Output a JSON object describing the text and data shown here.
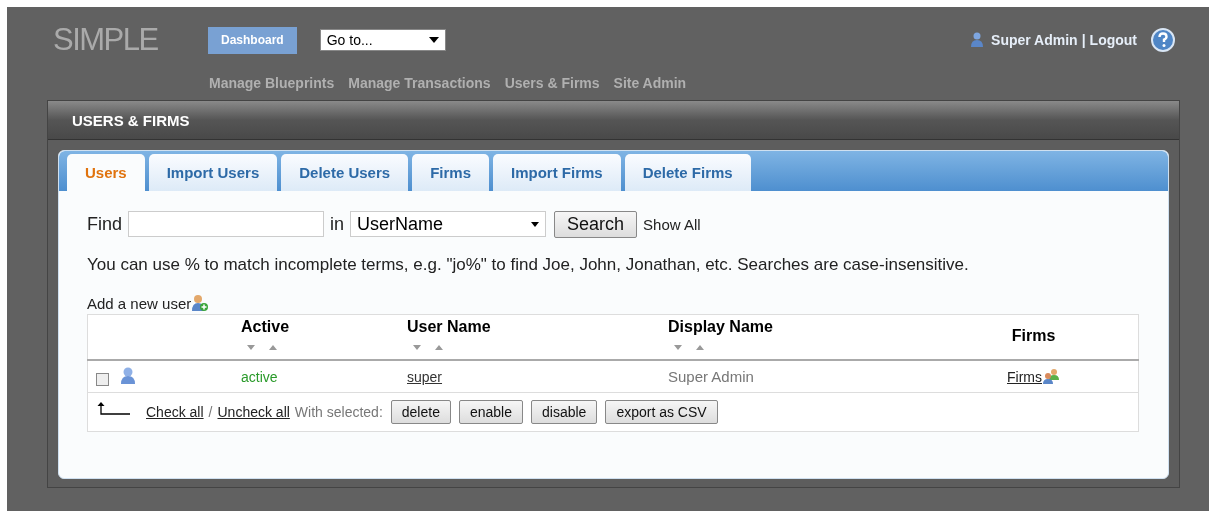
{
  "logo": "SIMPLE",
  "dashboard_button": "Dashboard",
  "goto_select": {
    "value": "Go to..."
  },
  "user_menu": {
    "name": "Super Admin",
    "separator": "|",
    "logout": "Logout"
  },
  "nav": [
    "Manage Blueprints",
    "Manage Transactions",
    "Users & Firms",
    "Site Admin"
  ],
  "panel": {
    "title": "USERS & FIRMS"
  },
  "tabs": [
    {
      "label": "Users",
      "selected": true
    },
    {
      "label": "Import Users",
      "selected": false
    },
    {
      "label": "Delete Users",
      "selected": false
    },
    {
      "label": "Firms",
      "selected": false
    },
    {
      "label": "Import Firms",
      "selected": false
    },
    {
      "label": "Delete Firms",
      "selected": false
    }
  ],
  "search": {
    "find_label": "Find",
    "in_label": "in",
    "field_value": "UserName",
    "button": "Search",
    "show_all": "Show All"
  },
  "hint": "You can use % to match incomplete terms, e.g. \"jo%\" to find Joe, John, Jonathan, etc. Searches are case-insensitive.",
  "add_user": "Add a new user",
  "table": {
    "columns": [
      {
        "label": "Active",
        "sortable": true
      },
      {
        "label": "User Name",
        "sortable": true
      },
      {
        "label": "Display Name",
        "sortable": true
      },
      {
        "label": "Firms",
        "sortable": false
      }
    ],
    "rows": [
      {
        "checked": false,
        "active": "active",
        "user_name": "super",
        "display_name": "Super Admin",
        "firms": "Firms"
      }
    ]
  },
  "bulk": {
    "check_all": "Check all",
    "slash": "/",
    "uncheck_all": "Uncheck all",
    "with_selected": "With selected:",
    "buttons": [
      "delete",
      "enable",
      "disable",
      "export as CSV"
    ]
  }
}
